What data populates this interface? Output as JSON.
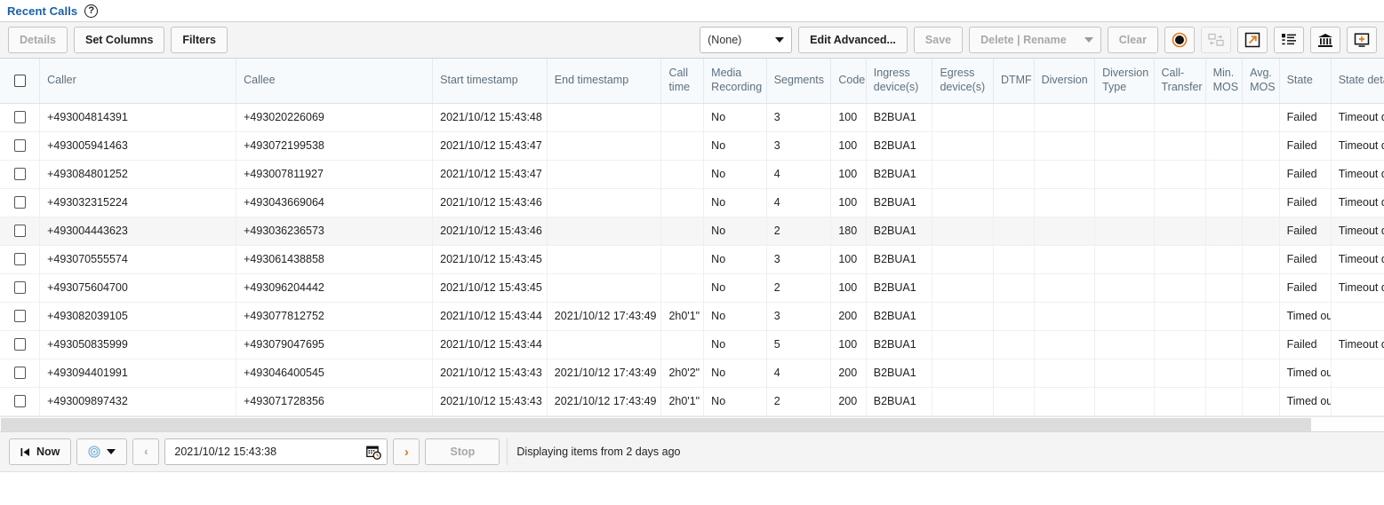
{
  "header": {
    "title": "Recent Calls",
    "help_icon": "question-mark-circle-icon"
  },
  "toolbar": {
    "details_label": "Details",
    "set_columns_label": "Set Columns",
    "filters_label": "Filters",
    "filter_select_value": "(None)",
    "edit_advanced_label": "Edit Advanced...",
    "save_label": "Save",
    "delete_rename_label": "Delete | Rename",
    "clear_label": "Clear",
    "icons": [
      {
        "name": "record-circle-icon",
        "enabled": true
      },
      {
        "name": "copy-folders-icon",
        "enabled": false
      },
      {
        "name": "open-external-icon",
        "enabled": true
      },
      {
        "name": "list-details-icon",
        "enabled": true
      },
      {
        "name": "bank-archive-icon",
        "enabled": true
      },
      {
        "name": "add-to-screen-icon",
        "enabled": true
      }
    ]
  },
  "table": {
    "columns": [
      "",
      "Caller",
      "Callee",
      "Start timestamp",
      "End timestamp",
      "Call time",
      "Media Recording",
      "Segments",
      "Code",
      "Ingress device(s)",
      "Egress device(s)",
      "DTMF",
      "Diversion",
      "Diversion Type",
      "Call-Transfer",
      "Min. MOS",
      "Avg. MOS",
      "State",
      "State details"
    ],
    "rows": [
      {
        "caller": "+493004814391",
        "callee": "+493020226069",
        "start": "2021/10/12 15:43:48",
        "end": "",
        "calltime": "",
        "media": "No",
        "segments": "3",
        "code": "100",
        "ingress": "B2BUA1",
        "egress": "",
        "dtmf": "",
        "diversion": "",
        "diversion_type": "",
        "call_transfer": "",
        "min_mos": "",
        "avg_mos": "",
        "state": "Failed",
        "state_details": "Timeout durin"
      },
      {
        "caller": "+493005941463",
        "callee": "+493072199538",
        "start": "2021/10/12 15:43:47",
        "end": "",
        "calltime": "",
        "media": "No",
        "segments": "3",
        "code": "100",
        "ingress": "B2BUA1",
        "egress": "",
        "dtmf": "",
        "diversion": "",
        "diversion_type": "",
        "call_transfer": "",
        "min_mos": "",
        "avg_mos": "",
        "state": "Failed",
        "state_details": "Timeout durin"
      },
      {
        "caller": "+493084801252",
        "callee": "+493007811927",
        "start": "2021/10/12 15:43:47",
        "end": "",
        "calltime": "",
        "media": "No",
        "segments": "4",
        "code": "100",
        "ingress": "B2BUA1",
        "egress": "",
        "dtmf": "",
        "diversion": "",
        "diversion_type": "",
        "call_transfer": "",
        "min_mos": "",
        "avg_mos": "",
        "state": "Failed",
        "state_details": "Timeout durin"
      },
      {
        "caller": "+493032315224",
        "callee": "+493043669064",
        "start": "2021/10/12 15:43:46",
        "end": "",
        "calltime": "",
        "media": "No",
        "segments": "4",
        "code": "100",
        "ingress": "B2BUA1",
        "egress": "",
        "dtmf": "",
        "diversion": "",
        "diversion_type": "",
        "call_transfer": "",
        "min_mos": "",
        "avg_mos": "",
        "state": "Failed",
        "state_details": "Timeout durin"
      },
      {
        "caller": "+493004443623",
        "callee": "+493036236573",
        "start": "2021/10/12 15:43:46",
        "end": "",
        "calltime": "",
        "media": "No",
        "segments": "2",
        "code": "180",
        "ingress": "B2BUA1",
        "egress": "",
        "dtmf": "",
        "diversion": "",
        "diversion_type": "",
        "call_transfer": "",
        "min_mos": "",
        "avg_mos": "",
        "state": "Failed",
        "state_details": "Timeout durin",
        "highlighted": true
      },
      {
        "caller": "+493070555574",
        "callee": "+493061438858",
        "start": "2021/10/12 15:43:45",
        "end": "",
        "calltime": "",
        "media": "No",
        "segments": "3",
        "code": "100",
        "ingress": "B2BUA1",
        "egress": "",
        "dtmf": "",
        "diversion": "",
        "diversion_type": "",
        "call_transfer": "",
        "min_mos": "",
        "avg_mos": "",
        "state": "Failed",
        "state_details": "Timeout durin"
      },
      {
        "caller": "+493075604700",
        "callee": "+493096204442",
        "start": "2021/10/12 15:43:45",
        "end": "",
        "calltime": "",
        "media": "No",
        "segments": "2",
        "code": "100",
        "ingress": "B2BUA1",
        "egress": "",
        "dtmf": "",
        "diversion": "",
        "diversion_type": "",
        "call_transfer": "",
        "min_mos": "",
        "avg_mos": "",
        "state": "Failed",
        "state_details": "Timeout durin"
      },
      {
        "caller": "+493082039105",
        "callee": "+493077812752",
        "start": "2021/10/12 15:43:44",
        "end": "2021/10/12 17:43:49",
        "calltime": "2h0'1\"",
        "media": "No",
        "segments": "3",
        "code": "200",
        "ingress": "B2BUA1",
        "egress": "",
        "dtmf": "",
        "diversion": "",
        "diversion_type": "",
        "call_transfer": "",
        "min_mos": "",
        "avg_mos": "",
        "state": "Timed out",
        "state_details": ""
      },
      {
        "caller": "+493050835999",
        "callee": "+493079047695",
        "start": "2021/10/12 15:43:44",
        "end": "",
        "calltime": "",
        "media": "No",
        "segments": "5",
        "code": "100",
        "ingress": "B2BUA1",
        "egress": "",
        "dtmf": "",
        "diversion": "",
        "diversion_type": "",
        "call_transfer": "",
        "min_mos": "",
        "avg_mos": "",
        "state": "Failed",
        "state_details": "Timeout durin"
      },
      {
        "caller": "+493094401991",
        "callee": "+493046400545",
        "start": "2021/10/12 15:43:43",
        "end": "2021/10/12 17:43:49",
        "calltime": "2h0'2\"",
        "media": "No",
        "segments": "4",
        "code": "200",
        "ingress": "B2BUA1",
        "egress": "",
        "dtmf": "",
        "diversion": "",
        "diversion_type": "",
        "call_transfer": "",
        "min_mos": "",
        "avg_mos": "",
        "state": "Timed out",
        "state_details": ""
      },
      {
        "caller": "+493009897432",
        "callee": "+493071728356",
        "start": "2021/10/12 15:43:43",
        "end": "2021/10/12 17:43:49",
        "calltime": "2h0'1\"",
        "media": "No",
        "segments": "2",
        "code": "200",
        "ingress": "B2BUA1",
        "egress": "",
        "dtmf": "",
        "diversion": "",
        "diversion_type": "",
        "call_transfer": "",
        "min_mos": "",
        "avg_mos": "",
        "state": "Timed out",
        "state_details": ""
      }
    ]
  },
  "bottombar": {
    "now_label": "Now",
    "target_icon": "target-circle-icon",
    "prev_label": "‹",
    "next_label": "›",
    "date_value": "2021/10/12 15:43:38",
    "calendar_icon": "calendar-clock-icon",
    "stop_label": "Stop",
    "status_text": "Displaying items from 2 days ago"
  },
  "colors": {
    "title_blue": "#1a5fa8",
    "state_red": "#b22222",
    "header_text": "#5c7080",
    "header_bg": "#f7fafc",
    "toolbar_bg": "#f4f4f4",
    "row_highlight": "#f6f6f6"
  }
}
